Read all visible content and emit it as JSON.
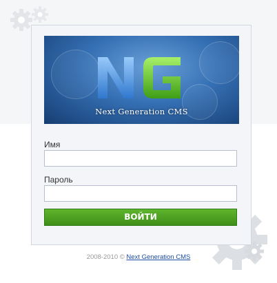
{
  "logo": {
    "letters": [
      "N",
      "G"
    ],
    "caption": "Next Generation CMS",
    "colors": {
      "n": "#4b8fe0",
      "g": "#5fbf2a",
      "banner": "#3570b4"
    }
  },
  "form": {
    "username_label": "Имя",
    "username_value": "",
    "password_label": "Пароль",
    "password_value": "",
    "submit_label": "ВОЙТИ"
  },
  "footer": {
    "copyright": "2008-2010 ©",
    "link_text": "Next Generation CMS"
  },
  "icons": [
    "gear-icon"
  ],
  "colors": {
    "accent": "#4a9a1f",
    "link": "#1c4ba0",
    "panel": "#f3f5f9"
  }
}
